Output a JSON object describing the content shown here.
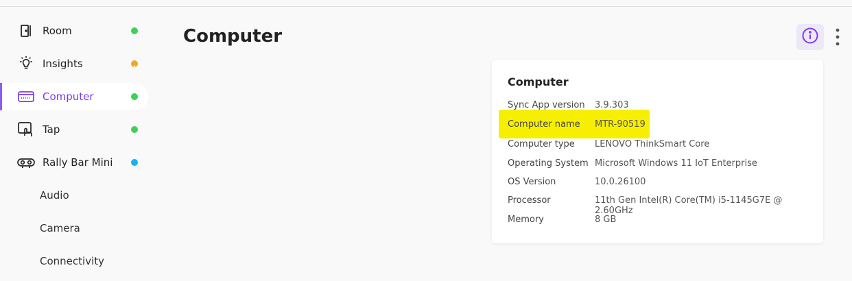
{
  "sidebar": {
    "items": [
      {
        "label": "Room",
        "icon": "door-icon",
        "status_color": "#3fcf5a"
      },
      {
        "label": "Insights",
        "icon": "lightbulb-icon",
        "status_color": "#f5a623"
      },
      {
        "label": "Computer",
        "icon": "computer-icon",
        "status_color": "#3fcf5a",
        "active": true
      },
      {
        "label": "Tap",
        "icon": "touch-panel-icon",
        "status_color": "#3fcf5a"
      },
      {
        "label": "Rally Bar Mini",
        "icon": "camera-bar-icon",
        "status_color": "#1ab0f0"
      }
    ],
    "subitems": [
      {
        "label": "Audio"
      },
      {
        "label": "Camera"
      },
      {
        "label": "Connectivity"
      }
    ]
  },
  "header": {
    "title": "Computer",
    "info_icon": "info-icon",
    "more_icon": "more-vertical-icon",
    "accent_color": "#7c3aed"
  },
  "card": {
    "title": "Computer",
    "highlight_color": "#f7ef00",
    "rows": [
      {
        "key": "Sync App version",
        "value": "3.9.303"
      },
      {
        "key": "Computer name",
        "value": "MTR-90519"
      },
      {
        "key": "Computer type",
        "value": "LENOVO ThinkSmart Core"
      },
      {
        "key": "Operating System",
        "value": "Microsoft Windows 11 IoT Enterprise"
      },
      {
        "key": "OS Version",
        "value": "10.0.26100"
      },
      {
        "key": "Processor",
        "value": "11th Gen Intel(R) Core(TM) i5-1145G7E @ 2.60GHz"
      },
      {
        "key": "Memory",
        "value": "8 GB"
      }
    ]
  }
}
